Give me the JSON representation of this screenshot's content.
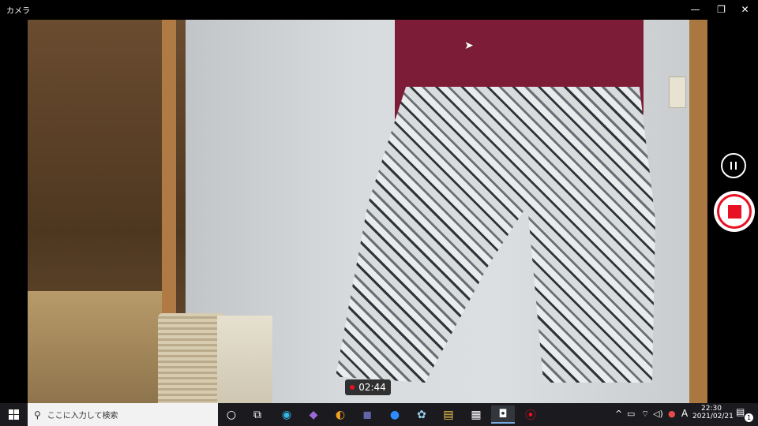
{
  "window": {
    "title": "カメラ",
    "minimize_glyph": "—",
    "maximize_glyph": "❐",
    "close_glyph": "✕"
  },
  "recording": {
    "timer": "02:44",
    "accent_color": "#e81123"
  },
  "controls": {
    "pause_icon": "pause-icon",
    "stop_icon": "stop-icon"
  },
  "taskbar": {
    "search_placeholder": "ここに入力して検索",
    "search_glyph": "⚲",
    "apps": [
      {
        "name": "cortana-icon",
        "glyph": "○"
      },
      {
        "name": "task-view-icon",
        "glyph": "⧉"
      },
      {
        "name": "edge-icon",
        "glyph": "◉"
      },
      {
        "name": "visual-studio-icon",
        "glyph": "◆"
      },
      {
        "name": "app-icon",
        "glyph": "◐"
      },
      {
        "name": "teams-icon",
        "glyph": "◼"
      },
      {
        "name": "zoom-icon",
        "glyph": "●"
      },
      {
        "name": "paint-icon",
        "glyph": "✿"
      },
      {
        "name": "file-explorer-icon",
        "glyph": "▤"
      },
      {
        "name": "film-icon",
        "glyph": "▦"
      },
      {
        "name": "camera-icon",
        "glyph": "◘"
      },
      {
        "name": "record-icon",
        "glyph": "⦿"
      }
    ],
    "tray": {
      "chevron": "^",
      "battery": "▭",
      "wifi": "⌔",
      "volume": "◁)",
      "app_tray": "●",
      "ime": "A",
      "time": "22:30",
      "date": "2021/02/21",
      "notification_glyph": "▤",
      "notification_count": "1"
    }
  }
}
